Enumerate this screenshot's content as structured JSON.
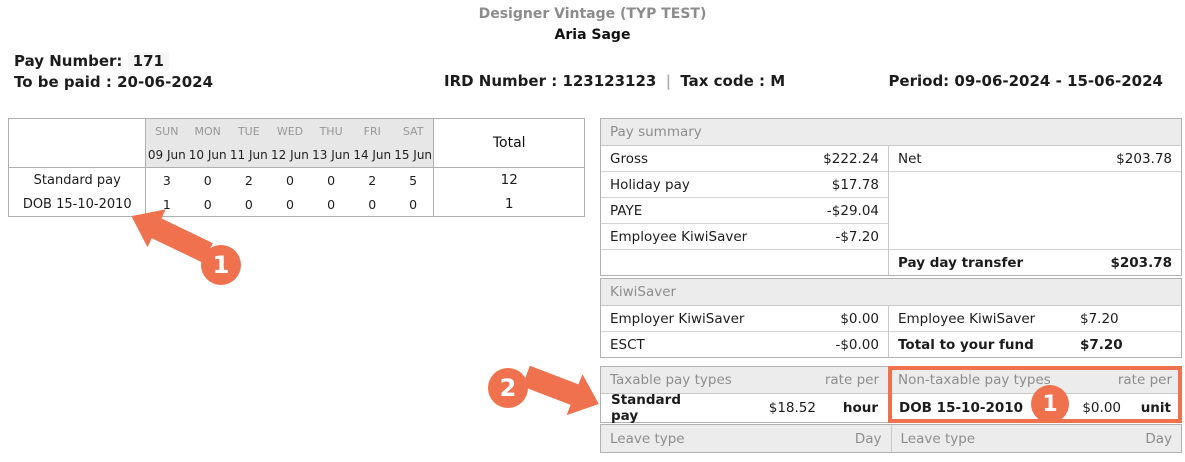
{
  "page": {
    "company": "Designer Vintage (TYP TEST)",
    "employee": "Aria Sage"
  },
  "info": {
    "pay_number_label": "Pay Number:",
    "pay_number_value": "171",
    "to_be_paid_label": "To be paid :",
    "to_be_paid_value": "20-06-2024",
    "ird_label": "IRD Number :",
    "ird_value": "123123123",
    "separator": "|",
    "tax_code_label": "Tax code :",
    "tax_code_value": "M",
    "period_label": "Period:",
    "period_value": "09-06-2024 - 15-06-2024"
  },
  "days_table": {
    "day_names": [
      "SUN",
      "MON",
      "TUE",
      "WED",
      "THU",
      "FRI",
      "SAT"
    ],
    "dates": [
      "09 Jun",
      "10 Jun",
      "11 Jun",
      "12 Jun",
      "13 Jun",
      "14 Jun",
      "15 Jun"
    ],
    "total_label": "Total",
    "rows": [
      {
        "label": "Standard pay",
        "values": [
          "3",
          "0",
          "2",
          "0",
          "0",
          "2",
          "5"
        ],
        "total": "12"
      },
      {
        "label": "DOB 15-10-2010",
        "values": [
          "1",
          "0",
          "0",
          "0",
          "0",
          "0",
          "0"
        ],
        "total": "1"
      }
    ]
  },
  "pay_summary": {
    "title": "Pay summary",
    "rows": [
      {
        "label": "Gross",
        "value": "$222.24"
      },
      {
        "label": "Holiday pay",
        "value": "$17.78"
      },
      {
        "label": "PAYE",
        "value": "-$29.04"
      },
      {
        "label": "Employee KiwiSaver",
        "value": "-$7.20"
      }
    ],
    "net_label": "Net",
    "net_value": "$203.78",
    "transfer_label": "Pay day transfer",
    "transfer_value": "$203.78"
  },
  "kiwisaver": {
    "title": "KiwiSaver",
    "left_rows": [
      {
        "label": "Employer KiwiSaver",
        "value": "$0.00"
      },
      {
        "label": "ESCT",
        "value": "-$0.00"
      }
    ],
    "right_rows": [
      {
        "label": "Employee KiwiSaver",
        "value": "$7.20"
      },
      {
        "label": "Total to your fund",
        "value": "$7.20"
      }
    ]
  },
  "pay_types": {
    "taxable_title": "Taxable pay types",
    "non_taxable_title": "Non-taxable pay types",
    "rate_per_label": "rate per",
    "taxable_row": {
      "name": "Standard pay",
      "rate": "$18.52",
      "per": "hour"
    },
    "non_taxable_row": {
      "name": "DOB 15-10-2010",
      "rate": "$0.00",
      "per": "unit"
    }
  },
  "leave": {
    "title": "Leave type",
    "unit": "Day"
  },
  "annotations": {
    "badge_1": "1",
    "badge_2": "2",
    "accent_color": "#F0714D"
  }
}
